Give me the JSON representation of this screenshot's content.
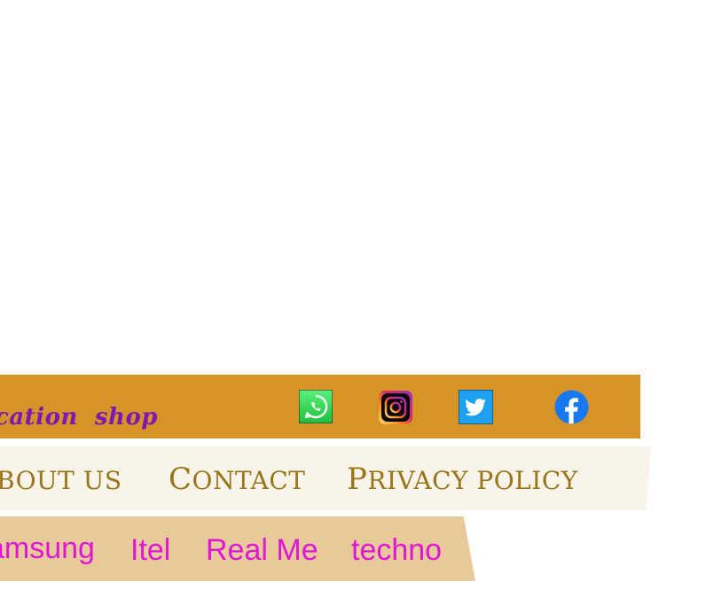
{
  "header": {
    "tagline": "cation  shop",
    "social": [
      {
        "name": "whatsapp",
        "icon": "whatsapp-icon",
        "color": "#25d366"
      },
      {
        "name": "instagram",
        "icon": "instagram-icon",
        "color": "#c32aa3"
      },
      {
        "name": "twitter",
        "icon": "twitter-icon",
        "color": "#1da1f2"
      },
      {
        "name": "facebook",
        "icon": "facebook-icon",
        "color": "#1877f2"
      }
    ]
  },
  "main_nav": {
    "items": [
      {
        "cap": "",
        "rest": "BOUT US"
      },
      {
        "cap": "C",
        "rest": "ONTACT"
      },
      {
        "cap": "P",
        "rest": "RIVACY POLICY"
      }
    ]
  },
  "brand_nav": {
    "items": [
      "amsung",
      "Itel",
      "Real Me",
      "techno"
    ]
  },
  "colors": {
    "top_bar": "#d69327",
    "main_nav_bg": "#f8f4ea",
    "main_nav_text": "#9a7418",
    "brand_nav_bg": "#e8c99a",
    "brand_text": "#e016d6",
    "tagline": "#7e18b0"
  }
}
